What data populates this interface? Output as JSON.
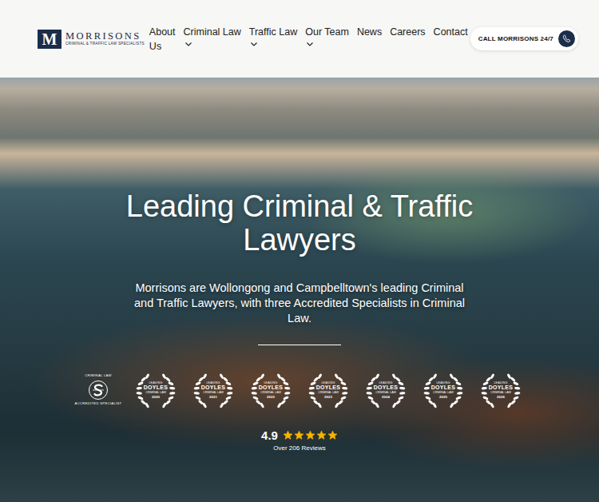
{
  "header": {
    "logo": {
      "letter": "M",
      "title": "MORRISONS",
      "subtitle": "CRIMINAL & TRAFFIC LAW SPECIALISTS"
    },
    "nav": [
      {
        "label": "About Us",
        "dropdown": false
      },
      {
        "label": "Criminal Law",
        "dropdown": true
      },
      {
        "label": "Traffic Law",
        "dropdown": true
      },
      {
        "label": "Our Team",
        "dropdown": true
      },
      {
        "label": "News",
        "dropdown": false
      },
      {
        "label": "Careers",
        "dropdown": false
      },
      {
        "label": "Contact",
        "dropdown": false
      }
    ],
    "call_button": {
      "label": "CALL MORRISONS 24/7"
    }
  },
  "hero": {
    "title": "Leading Criminal & Traffic Lawyers",
    "subtitle": "Morrisons are Wollongong and Campbelltown's leading Criminal and Traffic Lawyers, with three Accredited Specialists in Criminal Law.",
    "badges": [
      {
        "kind": "specialist",
        "top": "CRIMINAL LAW",
        "bottom": "ACCREDITED SPECIALIST"
      },
      {
        "kind": "doyles",
        "top": "LEADING",
        "name": "DOYLES",
        "sub": "CRIMINAL LAW",
        "year": "2020"
      },
      {
        "kind": "doyles",
        "top": "LEADING",
        "name": "DOYLES",
        "sub": "CRIMINAL LAW",
        "year": "2021"
      },
      {
        "kind": "doyles",
        "top": "LEADING",
        "name": "DOYLES",
        "sub": "CRIMINAL LAW",
        "year": "2022"
      },
      {
        "kind": "doyles",
        "top": "LEADING",
        "name": "DOYLES",
        "sub": "CRIMINAL LAW",
        "year": "2023"
      },
      {
        "kind": "doyles",
        "top": "LEADING",
        "name": "DOYLES",
        "sub": "CRIMINAL LAW",
        "year": "2024"
      },
      {
        "kind": "doyles",
        "top": "LEADING",
        "name": "DOYLES",
        "sub": "CRIMINAL LAW",
        "year": "2025"
      },
      {
        "kind": "doyles",
        "top": "LEADING",
        "name": "DOYLES",
        "sub": "CRIMINAL LAW",
        "year": "2026"
      }
    ],
    "rating": {
      "value": "4.9",
      "stars": 5,
      "reviews": "Over 206 Reviews"
    }
  }
}
